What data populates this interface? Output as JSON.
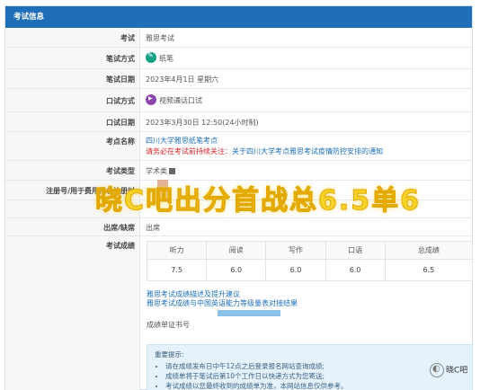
{
  "panel": {
    "title": "考试信息"
  },
  "rows": {
    "exam": {
      "label": "考试",
      "value": "雅思考试"
    },
    "method": {
      "label": "笔试方式",
      "value": "纸笔"
    },
    "written_date": {
      "label": "笔试日期",
      "value": "2023年4月1日 星期六"
    },
    "speaking_method": {
      "label": "口试方式",
      "value": "视频通话口试"
    },
    "speaking_date": {
      "label": "口试日期",
      "value": "2023年3月30日 12:50(24小时制)"
    },
    "venue": {
      "label": "考点名称",
      "value": "四川大学雅思纸笔考点",
      "notice_prefix": "请务必在考试前持续关注：",
      "notice_link": "关于四川大学考点雅思考试疫情防控安排的通知"
    },
    "type": {
      "label": "考试类型",
      "value": "学术类"
    },
    "reg": {
      "label": "注册号/用于费用报名注册时"
    },
    "attendance": {
      "label": "出席/缺席",
      "value": "出席"
    },
    "scores": {
      "label": "考试成绩"
    }
  },
  "scores_table": {
    "headers": [
      "听力",
      "阅读",
      "写作",
      "口语",
      "总成绩"
    ],
    "values": [
      "7.5",
      "6.0",
      "6.0",
      "6.0",
      "6.5"
    ]
  },
  "links": {
    "describe": "雅思考试成绩描述及提升建议",
    "mapping": "雅思考试成绩与中国英语能力等级量表对接结果"
  },
  "report_label": "成绩单证书号",
  "hints": {
    "title": "重要提示:",
    "items": [
      "请在成绩发布日中午12点之后登录报名网站查询成绩;",
      "成绩单将于笔试后第10个工作日以快递方式为您寄送;",
      "考试成绩以您最终收到的成绩单为准，本网站信息仅供参考。"
    ]
  },
  "watermark_text": "晓C吧出分首战总6.5单6",
  "logo_text": "晓C吧",
  "colors": {
    "header": "#1f6fb8",
    "watermark": "#f7d22a",
    "notice": "#d9242a"
  }
}
